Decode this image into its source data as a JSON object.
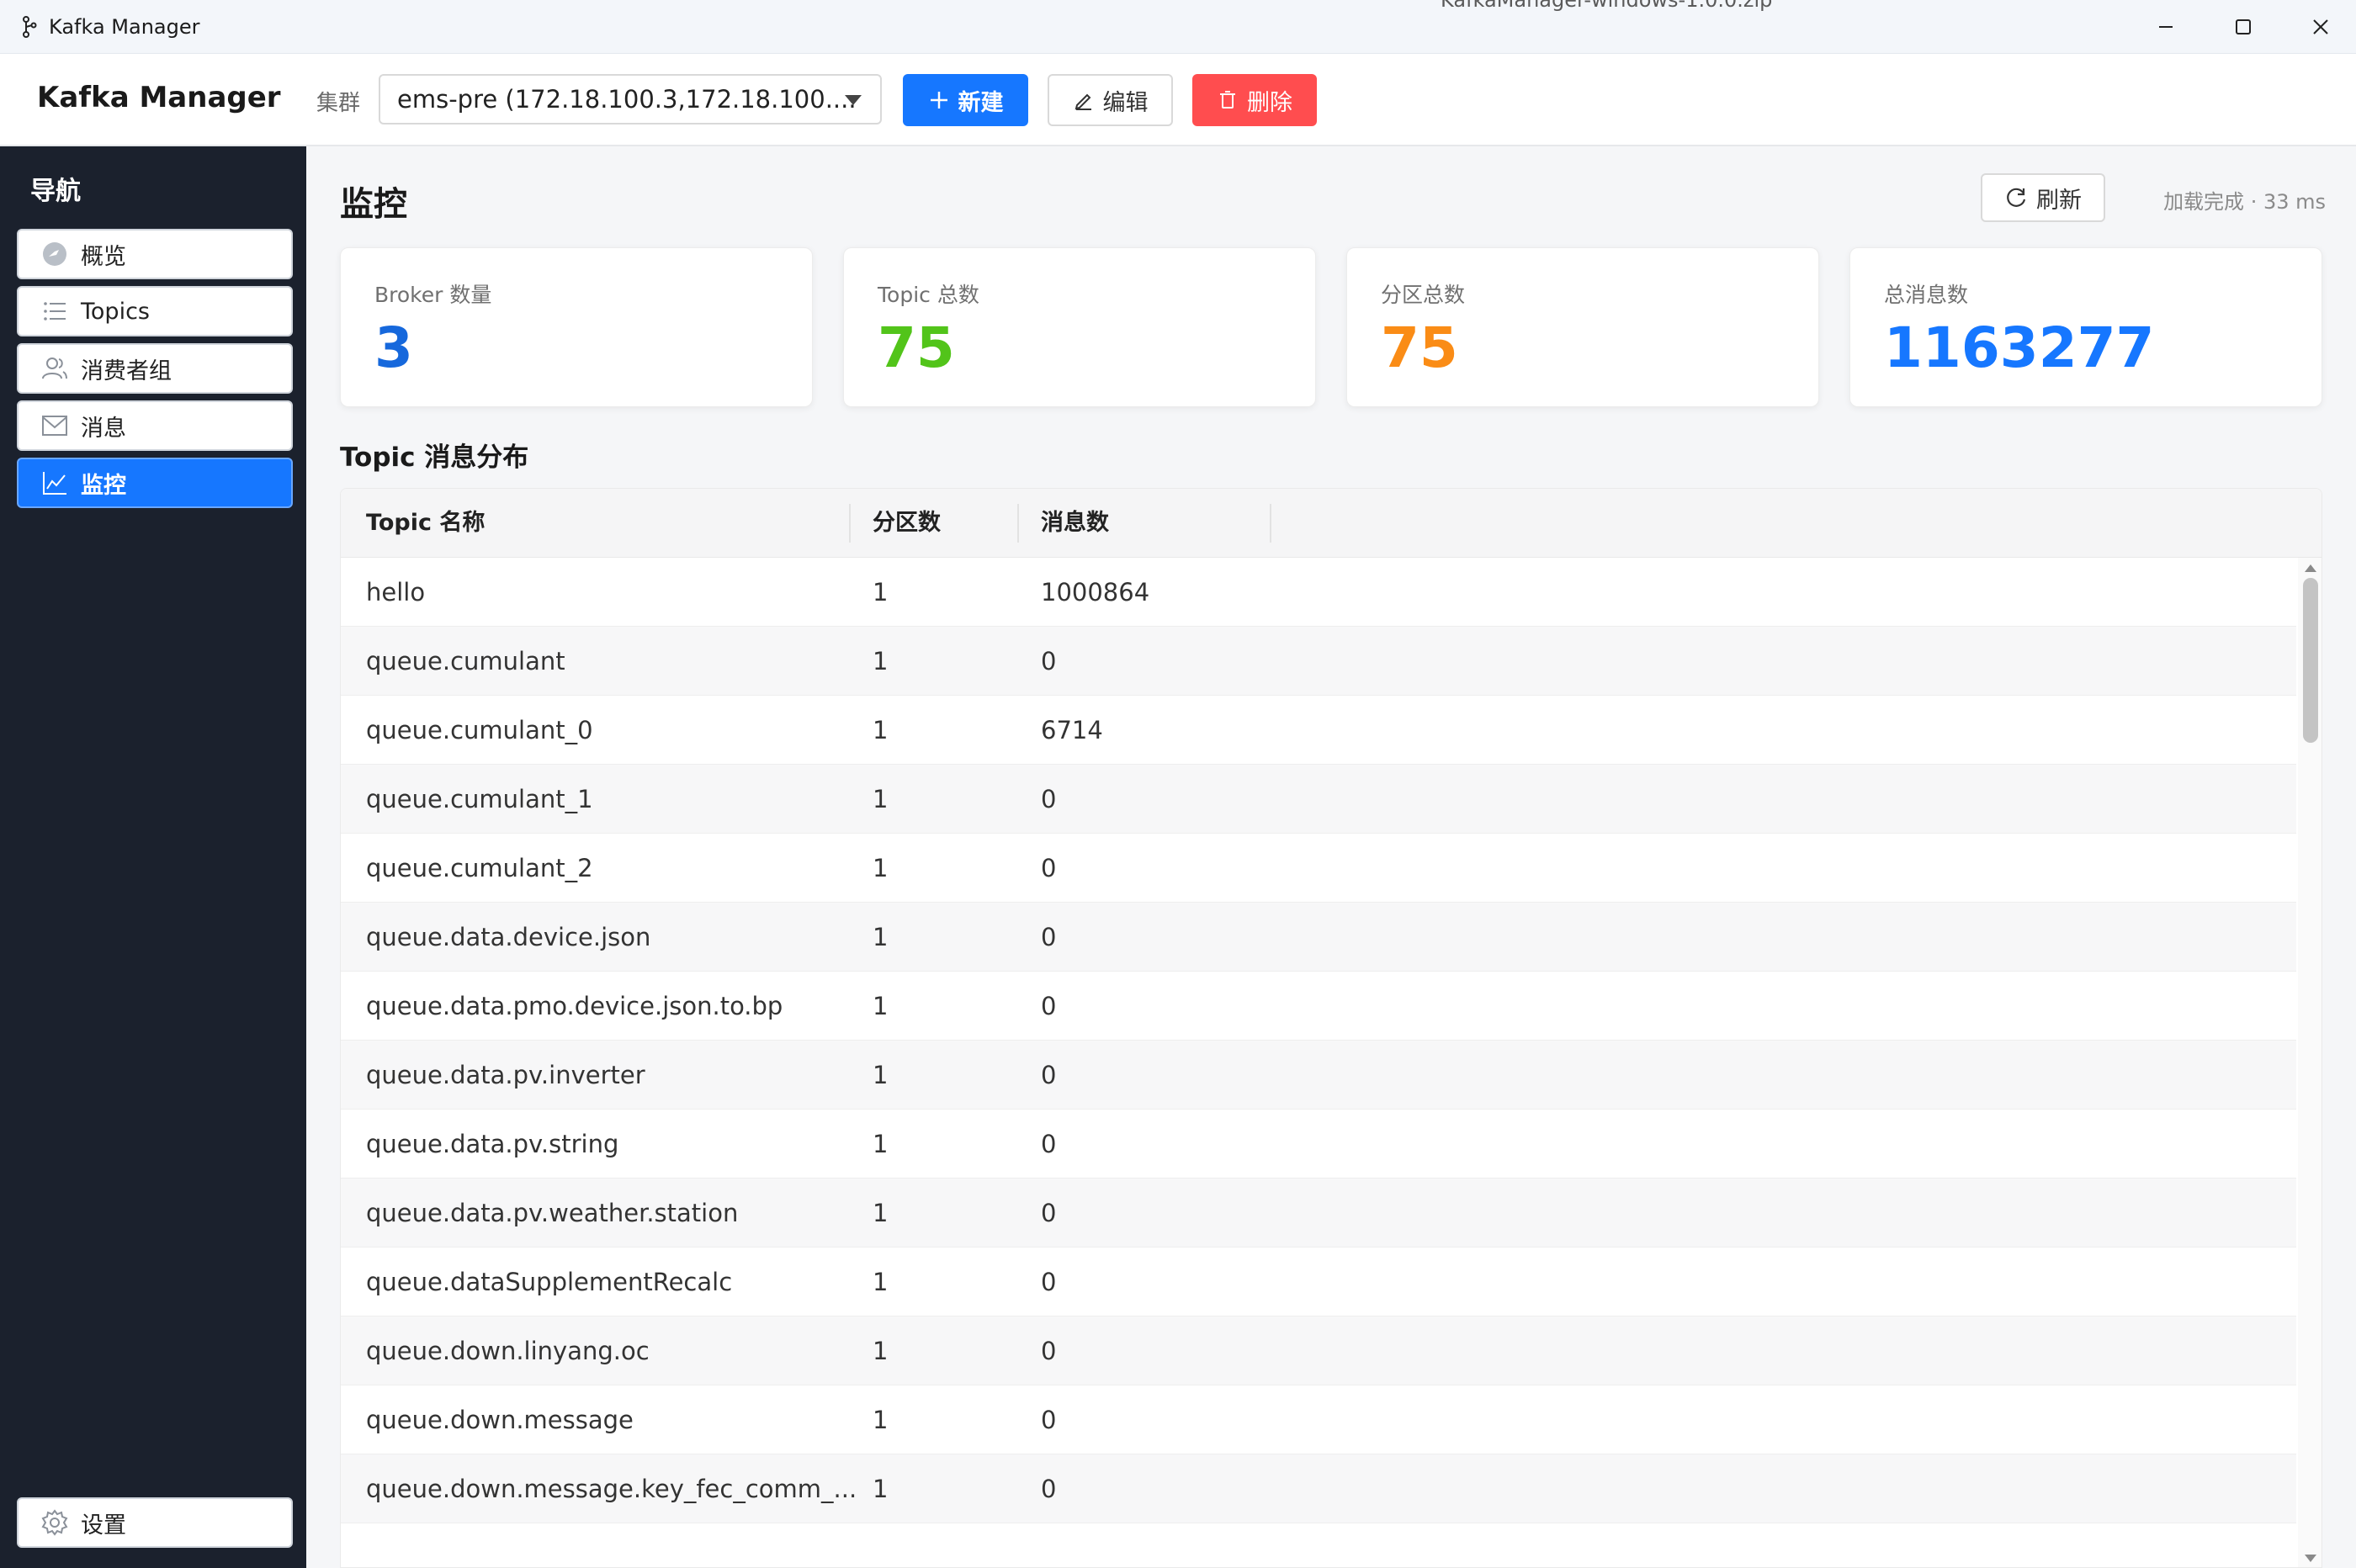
{
  "window": {
    "title": "Kafka Manager",
    "behind_text": "KafkaManager-windows-1.0.0.zip"
  },
  "toolbar": {
    "brand": "Kafka Manager",
    "cluster_label": "集群",
    "cluster_value": "ems-pre (172.18.100.3,172.18.100....",
    "new_label": "新建",
    "edit_label": "编辑",
    "delete_label": "删除"
  },
  "sidebar": {
    "title": "导航",
    "items": [
      {
        "label": "概览",
        "icon": "dashboard-icon"
      },
      {
        "label": "Topics",
        "icon": "list-icon"
      },
      {
        "label": "消费者组",
        "icon": "users-icon"
      },
      {
        "label": "消息",
        "icon": "mail-icon"
      },
      {
        "label": "监控",
        "icon": "line-chart-icon",
        "active": true
      }
    ],
    "settings_label": "设置"
  },
  "main": {
    "title": "监控",
    "refresh_label": "刷新",
    "status": "加载完成 · 33 ms",
    "stats": [
      {
        "label": "Broker 数量",
        "value": "3",
        "color": "#1668dc"
      },
      {
        "label": "Topic 总数",
        "value": "75",
        "color": "#52c41a"
      },
      {
        "label": "分区总数",
        "value": "75",
        "color": "#fa8c16"
      },
      {
        "label": "总消息数",
        "value": "1163277",
        "color": "#1677ff"
      }
    ],
    "section_title": "Topic 消息分布",
    "table": {
      "headers": {
        "name": "Topic 名称",
        "partitions": "分区数",
        "messages": "消息数"
      },
      "rows": [
        {
          "name": "hello",
          "partitions": "1",
          "messages": "1000864"
        },
        {
          "name": "queue.cumulant",
          "partitions": "1",
          "messages": "0"
        },
        {
          "name": "queue.cumulant_0",
          "partitions": "1",
          "messages": "6714"
        },
        {
          "name": "queue.cumulant_1",
          "partitions": "1",
          "messages": "0"
        },
        {
          "name": "queue.cumulant_2",
          "partitions": "1",
          "messages": "0"
        },
        {
          "name": "queue.data.device.json",
          "partitions": "1",
          "messages": "0"
        },
        {
          "name": "queue.data.pmo.device.json.to.bp",
          "partitions": "1",
          "messages": "0"
        },
        {
          "name": "queue.data.pv.inverter",
          "partitions": "1",
          "messages": "0"
        },
        {
          "name": "queue.data.pv.string",
          "partitions": "1",
          "messages": "0"
        },
        {
          "name": "queue.data.pv.weather.station",
          "partitions": "1",
          "messages": "0"
        },
        {
          "name": "queue.dataSupplementRecalc",
          "partitions": "1",
          "messages": "0"
        },
        {
          "name": "queue.down.linyang.oc",
          "partitions": "1",
          "messages": "0"
        },
        {
          "name": "queue.down.message",
          "partitions": "1",
          "messages": "0"
        },
        {
          "name": "queue.down.message.key_fec_comm_...",
          "partitions": "1",
          "messages": "0"
        }
      ]
    }
  }
}
